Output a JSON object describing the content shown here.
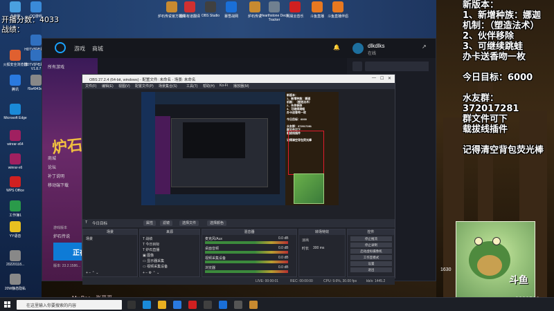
{
  "overlay_stats": {
    "broadcast_count": "开播分数：4033",
    "record": "战绩："
  },
  "notice": {
    "lines": [
      "新版本：",
      "1、新增种族：娜迦",
      "机制：（塑造法术）",
      "2、伙伴移除",
      "3、可继续跳蛙",
      "办卡送香吻一枚",
      "",
      "今日目标：6000",
      "",
      "水友群：372017281",
      "群文件可下",
      "载拔线插件",
      "",
      "记得清空背包荧光棒"
    ]
  },
  "desktop_icons": [
    {
      "label": "此电脑",
      "color": "#4aa0e0"
    },
    {
      "label": "QQ游戏",
      "color": "#3a8ad8"
    },
    {
      "label": "炉石传说官方插件",
      "color": "#c88a30"
    },
    {
      "label": "网易有道翻译",
      "color": "#d03030"
    },
    {
      "label": "OBS Studio",
      "color": "#404040"
    },
    {
      "label": "暴雪战网",
      "color": "#1a6fd8"
    },
    {
      "label": "炉石传说",
      "color": "#c88a30"
    },
    {
      "label": "Hearthstone Deck Tracker",
      "color": "#708090"
    },
    {
      "label": "网易云音乐",
      "color": "#d02020"
    },
    {
      "label": "斗鱼直播",
      "color": "#e87820"
    },
    {
      "label": "斗鱼直播伴侣",
      "color": "#e87820"
    },
    {
      "label": "HDTV炉石助手V1.8.7",
      "color": "#3070c0"
    },
    {
      "label": "火狐安全浏览器",
      "color": "#e06030"
    },
    {
      "label": "HDTV炉石助手V1.8.7",
      "color": "#3070c0"
    },
    {
      "label": "腾讯",
      "color": "#2a7ae0"
    },
    {
      "label": "f9a4943e1",
      "color": "#888888"
    },
    {
      "label": "Microsoft Edge",
      "color": "#1a8ad8"
    },
    {
      "label": "winrar-x64",
      "color": "#a02060"
    },
    {
      "label": "winrar-x6",
      "color": "#a02060"
    },
    {
      "label": "WPS Office",
      "color": "#d02020"
    },
    {
      "label": "工作簿1",
      "color": "#2a9a4a"
    },
    {
      "label": "YY语音",
      "color": "#e8c020"
    },
    {
      "label": "20220118...",
      "color": "#888888"
    },
    {
      "label": "20W静态隐私",
      "color": "#888888"
    }
  ],
  "bnet": {
    "nav": [
      "游戏",
      "商城"
    ],
    "username": "dlkdlks",
    "status": "在线",
    "sidebar_items": [
      "所有游戏",
      "商城",
      "论坛",
      "补丁说明",
      "移动端下载"
    ],
    "game_title": "炉石",
    "version_label": "游戏版本",
    "version_value": "炉石传说",
    "play_label": "正在",
    "version": "版本: 23.2.1586..."
  },
  "obs": {
    "title": "OBS 27.2.4 (64-bit, windows) - 配置文件: 未命名 - 场景: 未命名",
    "menu": [
      "文件(F)",
      "编辑(E)",
      "视图(V)",
      "配置文件(P)",
      "场景集合(S)",
      "工具(T)",
      "帮助(H)",
      "Ko-Fi",
      "播放器(M)"
    ],
    "ctrlbar": {
      "source_name": "今日目标",
      "buttons": [
        "属性",
        "滤镜",
        "选择文件",
        "选择颜色"
      ]
    },
    "docks": {
      "scenes_title": "场景",
      "scene_item": "场景",
      "sources_title": "来源",
      "sources": [
        "战绩",
        "今日目标",
        "炉石直播",
        "图像",
        "显示器采集",
        "视频采集设备"
      ],
      "mixer_title": "混音器",
      "mixer": [
        {
          "name": "麦克风/Aux",
          "db": "0.0 dB"
        },
        {
          "name": "桌面音频",
          "db": "0.0 dB"
        },
        {
          "name": "视频采集设备",
          "db": "0.0 dB"
        },
        {
          "name": "浏览器",
          "db": "0.0 dB"
        }
      ],
      "transitions_title": "转场特效",
      "transition_value": "淡出",
      "duration_label": "时长",
      "duration_value": "300 ms",
      "controls_title": "控件",
      "controls": [
        "停止推流",
        "停止录制",
        "启动虚拟摄像机",
        "工作室模式",
        "设置",
        "退出"
      ]
    },
    "status": {
      "live": "LIVE: 00:00:01",
      "rec": "REC: 00:00:00",
      "cpu": "CPU: 9.6%, 30.00 fps",
      "kbps": "kb/s: 1445.2"
    }
  },
  "bottom_left_num": "1630",
  "music": "My Bae - 张平平",
  "douyu": "斗鱼",
  "room_id": "9332506",
  "taskbar": {
    "search_placeholder": "在这里输入你要搜索的内容"
  }
}
